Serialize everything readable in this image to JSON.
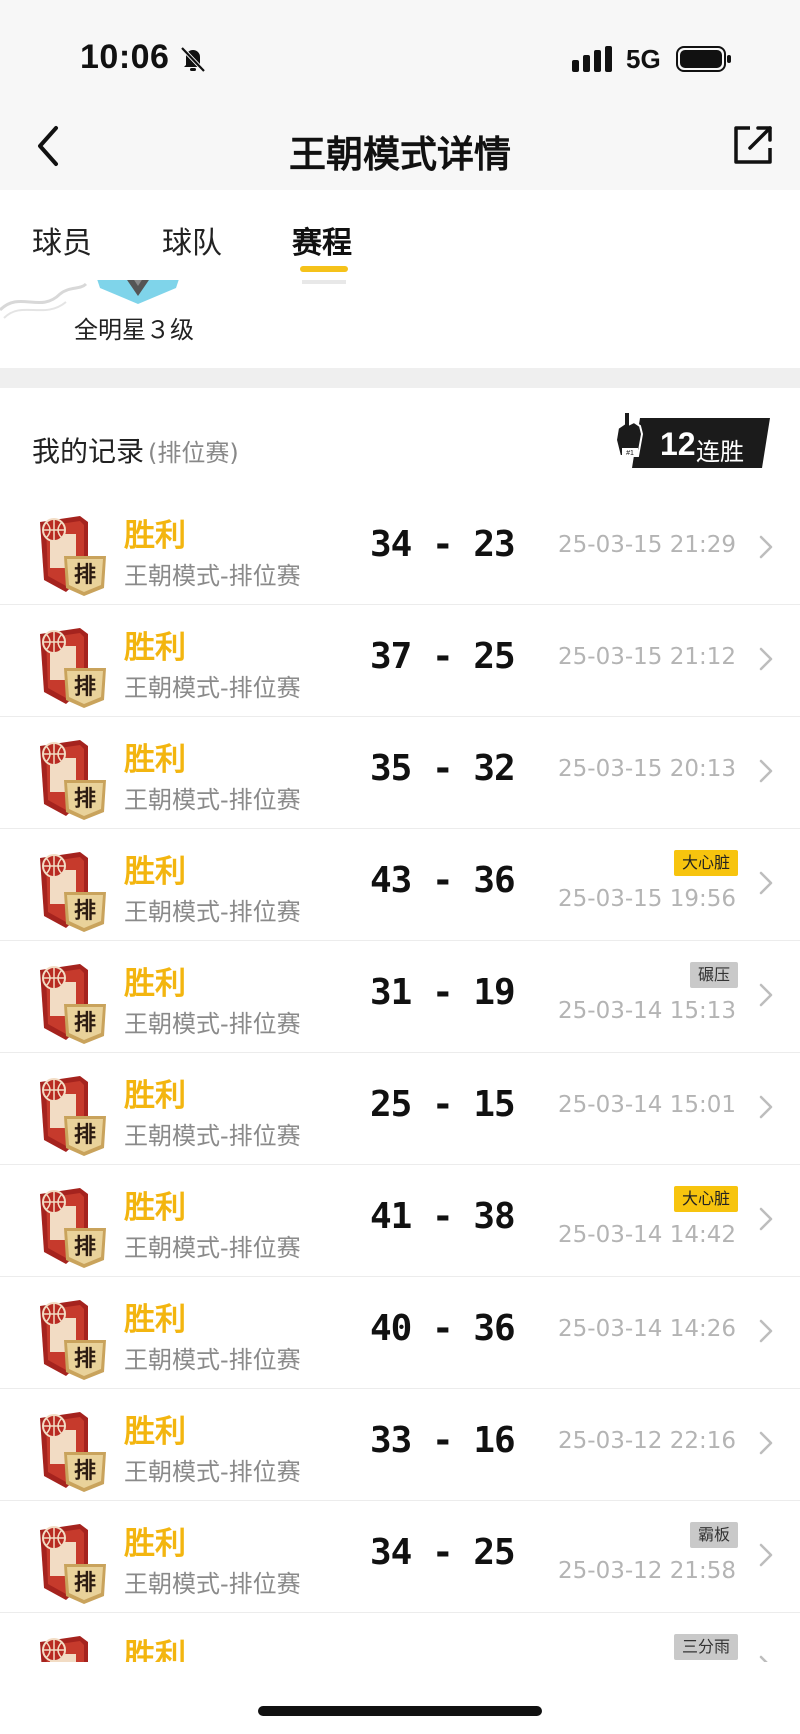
{
  "status_bar": {
    "time": "10:06",
    "network": "5G"
  },
  "nav": {
    "title": "王朝模式详情"
  },
  "tabs": [
    {
      "label": "球员",
      "active": false
    },
    {
      "label": "球队",
      "active": false
    },
    {
      "label": "赛程",
      "active": true
    }
  ],
  "player_level": "全明星３级",
  "record": {
    "title": "我的记录",
    "subtitle": "(排位赛)",
    "streak_number": "12",
    "streak_label": "连胜"
  },
  "colors": {
    "accent": "#f5c21a",
    "win": "#f3b50f",
    "tag_gold": "#f7c40e",
    "tag_gray": "#c9c9c9"
  },
  "matches": [
    {
      "result": "胜利",
      "mode": "王朝模式-排位赛",
      "score": "34 - 23",
      "time": "25-03-15 21:29",
      "tag": "",
      "tag_style": ""
    },
    {
      "result": "胜利",
      "mode": "王朝模式-排位赛",
      "score": "37 - 25",
      "time": "25-03-15 21:12",
      "tag": "",
      "tag_style": ""
    },
    {
      "result": "胜利",
      "mode": "王朝模式-排位赛",
      "score": "35 - 32",
      "time": "25-03-15 20:13",
      "tag": "",
      "tag_style": ""
    },
    {
      "result": "胜利",
      "mode": "王朝模式-排位赛",
      "score": "43 - 36",
      "time": "25-03-15 19:56",
      "tag": "大心脏",
      "tag_style": "gold"
    },
    {
      "result": "胜利",
      "mode": "王朝模式-排位赛",
      "score": "31 - 19",
      "time": "25-03-14 15:13",
      "tag": "碾压",
      "tag_style": "gray"
    },
    {
      "result": "胜利",
      "mode": "王朝模式-排位赛",
      "score": "25 - 15",
      "time": "25-03-14 15:01",
      "tag": "",
      "tag_style": ""
    },
    {
      "result": "胜利",
      "mode": "王朝模式-排位赛",
      "score": "41 - 38",
      "time": "25-03-14 14:42",
      "tag": "大心脏",
      "tag_style": "gold"
    },
    {
      "result": "胜利",
      "mode": "王朝模式-排位赛",
      "score": "40 - 36",
      "time": "25-03-14 14:26",
      "tag": "",
      "tag_style": ""
    },
    {
      "result": "胜利",
      "mode": "王朝模式-排位赛",
      "score": "33 - 16",
      "time": "25-03-12 22:16",
      "tag": "",
      "tag_style": ""
    },
    {
      "result": "胜利",
      "mode": "王朝模式-排位赛",
      "score": "34 - 25",
      "time": "25-03-12 21:58",
      "tag": "霸板",
      "tag_style": "gray"
    },
    {
      "result": "胜利",
      "mode": "",
      "score": "",
      "time": "",
      "tag": "三分雨",
      "tag_style": "gray"
    }
  ]
}
